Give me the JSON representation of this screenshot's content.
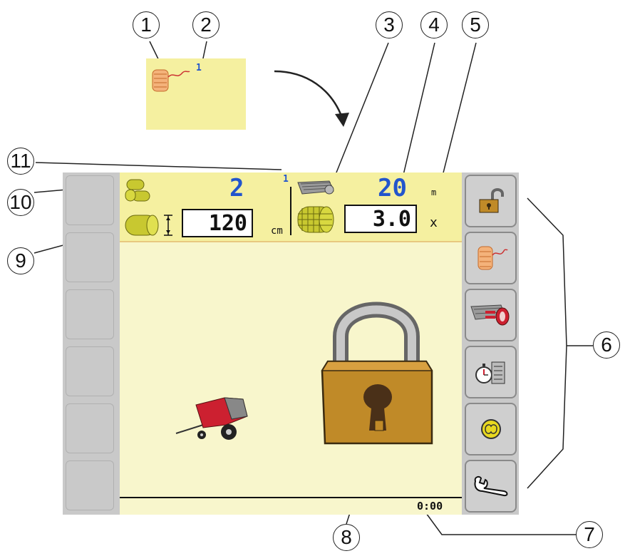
{
  "callouts": [
    "1",
    "2",
    "3",
    "4",
    "5",
    "6",
    "7",
    "8",
    "9",
    "10",
    "11"
  ],
  "preview": {
    "twine_badge": "1"
  },
  "header": {
    "bale_count": "2",
    "bale_length": "120",
    "bale_length_unit": "cm",
    "wrap_badge": "1",
    "net_length": "20",
    "net_length_unit": "m",
    "net_layers": "3.0",
    "net_layers_unit": "x"
  },
  "status": {
    "time": "0:00"
  },
  "softkeys": [
    {
      "icon": "unlock-icon"
    },
    {
      "icon": "twine-icon"
    },
    {
      "icon": "reset-net-counter-icon"
    },
    {
      "icon": "timer-list-icon"
    },
    {
      "icon": "sensor-icon"
    },
    {
      "icon": "wrench-icon"
    }
  ],
  "colors": {
    "header": "#f5f0a0",
    "main": "#f8f6cc",
    "panel": "#c9c9c9",
    "value_blue": "#2255cc"
  }
}
